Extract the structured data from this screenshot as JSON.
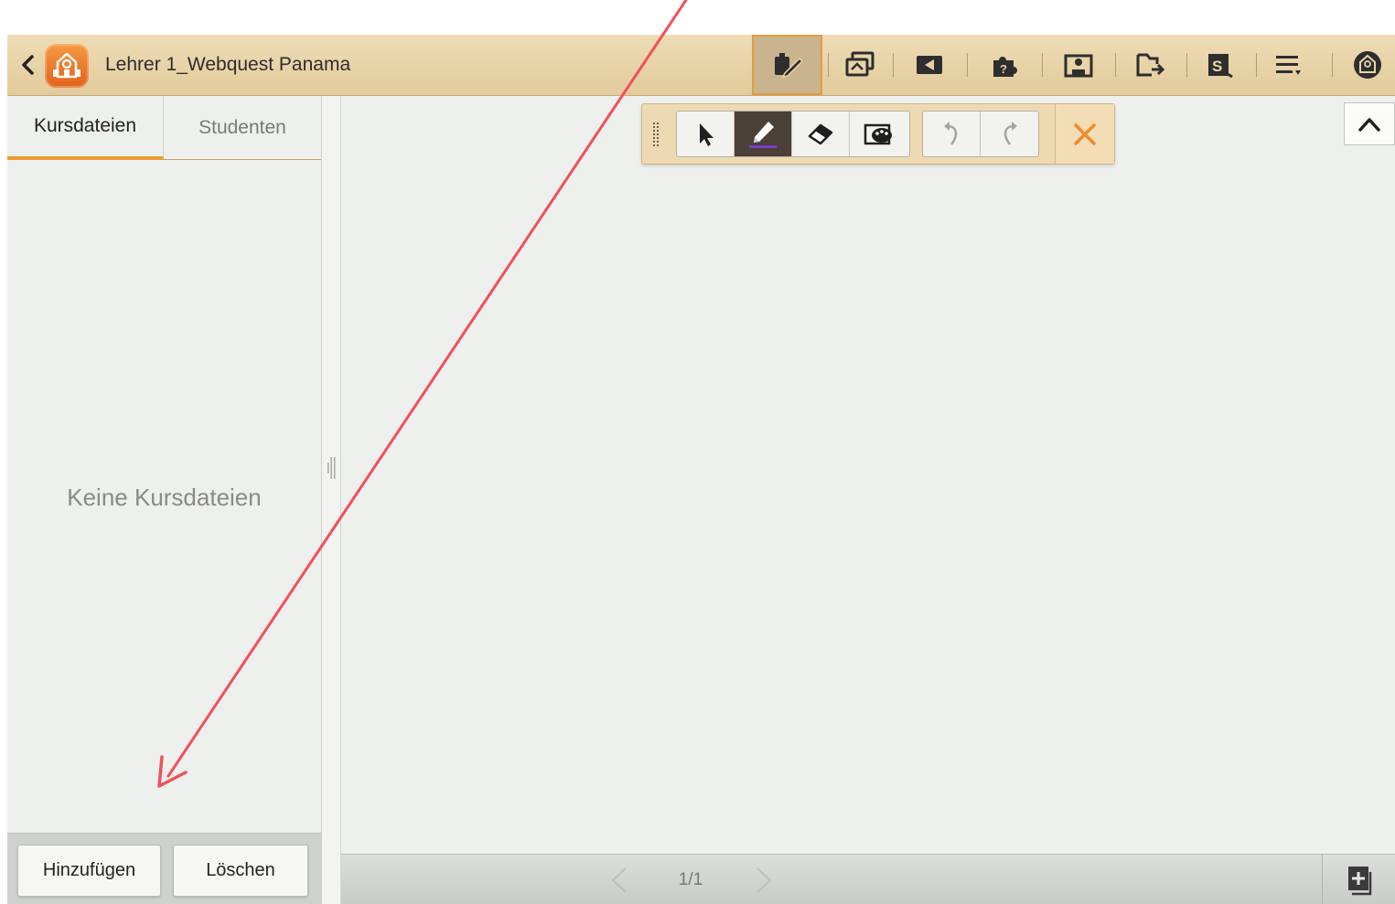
{
  "header": {
    "course_title": "Lehrer 1_Webquest Panama",
    "toolbar_icons": [
      "draw-mode-icon",
      "screen-share-icon",
      "broadcast-icon",
      "quiz-icon",
      "presentation-icon",
      "file-transfer-icon",
      "student-screen-icon",
      "menu-icon",
      "school-icon"
    ]
  },
  "sidebar": {
    "tabs": [
      {
        "label": "Kursdateien",
        "active": true
      },
      {
        "label": "Studenten",
        "active": false
      }
    ],
    "empty_message": "Keine Kursdateien",
    "buttons": {
      "add": "Hinzufügen",
      "delete": "Löschen"
    }
  },
  "drawing_toolbar": {
    "tools": [
      "select-arrow-icon",
      "pen-icon",
      "eraser-icon",
      "palette-icon"
    ],
    "selected_tool": "pen-icon",
    "history": [
      "undo-icon",
      "redo-icon"
    ],
    "close": "close-icon"
  },
  "pager": {
    "page_label": "1/1"
  },
  "colors": {
    "accent": "#ef9a32",
    "title_bar": "#e8d4a8",
    "annotation_arrow": "#f1505c"
  }
}
